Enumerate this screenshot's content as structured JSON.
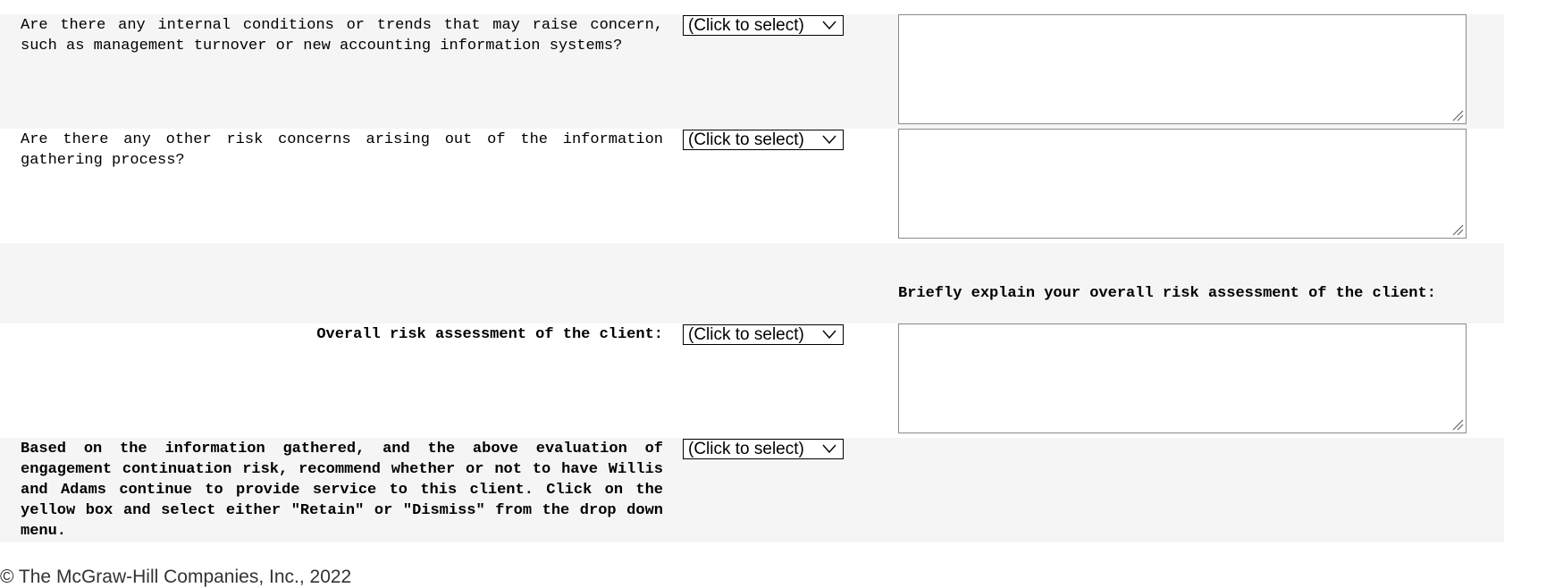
{
  "questions": [
    {
      "text": "Are there any internal conditions or trends that may raise concern, such as management turnover or new accounting information systems?",
      "select_value": "(Click to select)",
      "comment_value": ""
    },
    {
      "text": "Are there any other risk concerns arising out of the information gathering process?",
      "select_value": "(Click to select)",
      "comment_value": ""
    }
  ],
  "overall": {
    "explain_label": "Briefly explain your overall risk assessment of the client:",
    "label": "Overall risk assessment of the client:",
    "select_value": "(Click to select)",
    "comment_value": ""
  },
  "recommendation": {
    "text": "Based on the information gathered, and the above evaluation of engagement continuation risk, recommend whether or not to have Willis and Adams continue to provide service to this client. Click on the yellow box and select either \"Retain\" or \"Dismiss\" from the drop down menu.",
    "select_value": "(Click to select)"
  },
  "footer": {
    "copyright": "© The McGraw-Hill Companies, Inc., 2022"
  }
}
